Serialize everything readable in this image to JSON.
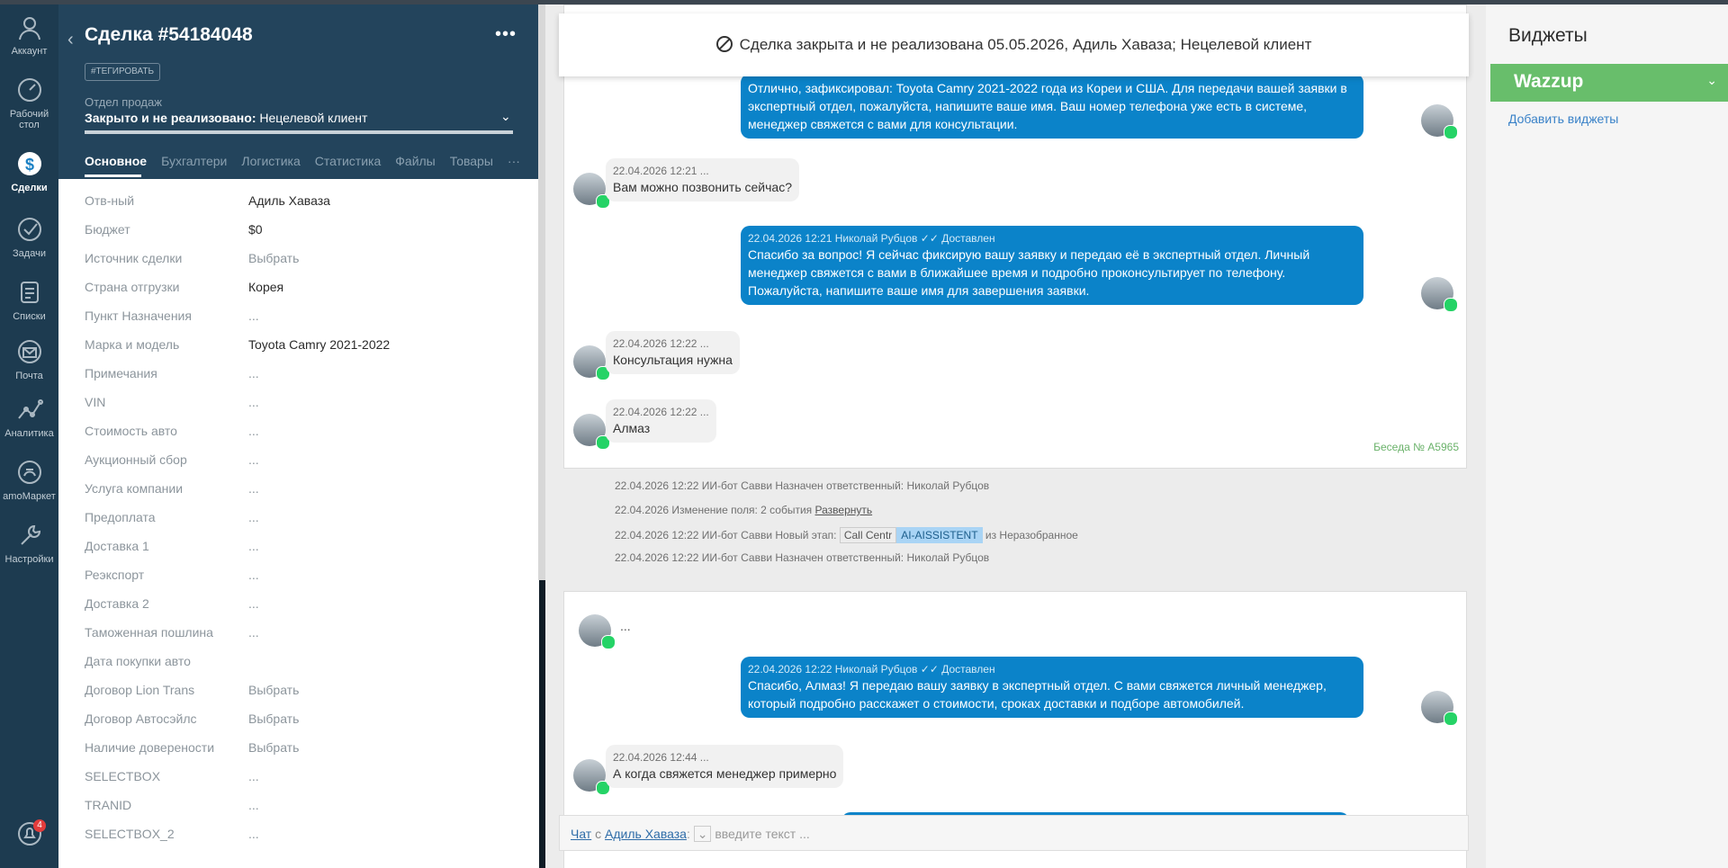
{
  "nav": {
    "items": [
      {
        "label": "Аккаунт",
        "icon": "account-icon"
      },
      {
        "label": "Рабочий стол",
        "icon": "dashboard-icon"
      },
      {
        "label": "Сделки",
        "icon": "deals-icon"
      },
      {
        "label": "Задачи",
        "icon": "tasks-icon"
      },
      {
        "label": "Списки",
        "icon": "lists-icon"
      },
      {
        "label": "Почта",
        "icon": "mail-icon"
      },
      {
        "label": "Аналитика",
        "icon": "analytics-icon"
      },
      {
        "label": "amoМаркет",
        "icon": "market-icon"
      },
      {
        "label": "Настройки",
        "icon": "settings-icon"
      }
    ],
    "notifications_count": "4"
  },
  "deal": {
    "title": "Сделка #54184048",
    "tag_button": "#ТЕГИРОВАТЬ",
    "pipeline_label": "Отдел продаж",
    "status_bold": "Закрыто и не реализовано:",
    "status_reason": " Нецелевой клиент",
    "tabs": [
      "Основное",
      "Бухгалтери",
      "Логистика",
      "Статистика",
      "Файлы",
      "Товары"
    ],
    "fields": [
      {
        "label": "Отв-ный",
        "value": "Адиль Хаваза"
      },
      {
        "label": "Бюджет",
        "value": "$0"
      },
      {
        "label": "Источник сделки",
        "value": "Выбрать"
      },
      {
        "label": "Страна отгрузки",
        "value": "Корея"
      },
      {
        "label": "Пункт Назначения",
        "value": "..."
      },
      {
        "label": "Марка и модель",
        "value": "Toyota Camry 2021-2022"
      },
      {
        "label": "Примечания",
        "value": "..."
      },
      {
        "label": "VIN",
        "value": "..."
      },
      {
        "label": "Стоимость авто",
        "value": "..."
      },
      {
        "label": "Аукционный сбор",
        "value": "..."
      },
      {
        "label": "Услуга компании",
        "value": "..."
      },
      {
        "label": "Предоплата",
        "value": "..."
      },
      {
        "label": "Доставка 1",
        "value": "..."
      },
      {
        "label": "Реэкспорт",
        "value": "..."
      },
      {
        "label": "Доставка 2",
        "value": "..."
      },
      {
        "label": "Таможенная пошлина",
        "value": "..."
      },
      {
        "label": "Дата покупки авто",
        "value": ""
      },
      {
        "label": "Договор Lion Trans",
        "value": "Выбрать"
      },
      {
        "label": "Договор Автосэйлс",
        "value": "Выбрать"
      },
      {
        "label": "Наличие доверености",
        "value": "Выбрать"
      },
      {
        "label": "SELECTBOX",
        "value": "..."
      },
      {
        "label": "TRANID",
        "value": "..."
      },
      {
        "label": "SELECTBOX_2",
        "value": "..."
      }
    ]
  },
  "feed": {
    "closed_banner": "Сделка закрыта и не реализована 05.05.2026, Адиль Хаваза; Нецелевой клиент",
    "messages": [
      {
        "dir": "out",
        "meta": "",
        "text": "Отлично, зафиксировал: Toyota Camry 2021-2022 года из Кореи и США. Для передачи вашей заявки в экспертный отдел, пожалуйста, напишите ваше имя. Ваш номер телефона уже есть в системе, менеджер свяжется с вами для консультации."
      },
      {
        "dir": "in",
        "meta": "22.04.2026 12:21 ...",
        "text": "Вам можно позвонить сейчас?"
      },
      {
        "dir": "out",
        "meta": "22.04.2026 12:21 Николай Рубцов ✓✓ Доставлен",
        "text": "Спасибо за вопрос! Я сейчас фиксирую вашу заявку и передаю её в экспертный отдел. Личный менеджер свяжется с вами в ближайшее время и подробно проконсультирует по телефону. Пожалуйста, напишите ваше имя для завершения заявки."
      },
      {
        "dir": "in",
        "meta": "22.04.2026 12:22 ...",
        "text": "Консультация нужна"
      },
      {
        "dir": "in",
        "meta": "22.04.2026 12:22 ...",
        "text": "Алмаз"
      }
    ],
    "conversation_number": "Беседа № A5965",
    "events": [
      {
        "text": "22.04.2026 12:22 ИИ-бот Савви Назначен ответственный: Николай Рубцов"
      },
      {
        "text": "22.04.2026 Изменение поля: 2 события ",
        "link": "Развернуть"
      },
      {
        "text": "22.04.2026 12:22 ИИ-бот Савви Новый этап: ",
        "pill1": "Call Centr",
        "pill2": "AI-AISSISTENT",
        "after": " из Неразобранное"
      },
      {
        "text": "22.04.2026 12:22 ИИ-бот Савви Назначен ответственный: Николай Рубцов"
      }
    ],
    "second_card": {
      "ellipsis": "...",
      "messages": [
        {
          "dir": "out",
          "meta": "22.04.2026 12:22 Николай Рубцов ✓✓ Доставлен",
          "text": "Спасибо, Алмаз! Я передаю вашу заявку в экспертный отдел. С вами свяжется личный менеджер, который подробно расскажет о стоимости, сроках доставки и подборе автомобилей."
        },
        {
          "dir": "in",
          "meta": "22.04.2026 12:44 ...",
          "text": "А когда свяжется менеджер примерно"
        }
      ]
    },
    "chat_input": {
      "prefix": "Чат",
      "with": " с ",
      "contact": "Адиль Хаваза",
      "colon": ":",
      "placeholder": "введите текст ..."
    }
  },
  "widgets": {
    "title": "Виджеты",
    "wazzup": "Wazzup",
    "add_link": "Добавить виджеты"
  }
}
